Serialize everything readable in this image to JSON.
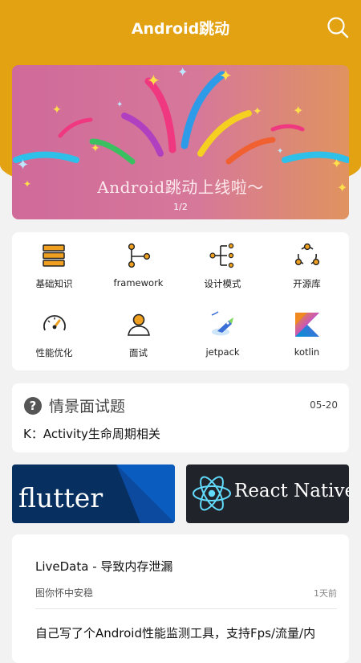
{
  "appbar": {
    "title": "Android跳动"
  },
  "banner": {
    "title": "Android跳动上线啦～",
    "page_indicator": "1/2"
  },
  "categories": [
    {
      "label": "基础知识",
      "icon": "layers-icon"
    },
    {
      "label": "framework",
      "icon": "branch-icon"
    },
    {
      "label": "设计模式",
      "icon": "tree-structure-icon"
    },
    {
      "label": "开源库",
      "icon": "cycle-icon"
    },
    {
      "label": "性能优化",
      "icon": "gauge-icon"
    },
    {
      "label": "面试",
      "icon": "person-icon"
    },
    {
      "label": "jetpack",
      "icon": "jetpack-logo-icon"
    },
    {
      "label": "kotlin",
      "icon": "kotlin-logo-icon"
    }
  ],
  "question": {
    "title": "情景面试题",
    "date": "05-20",
    "text": "K：Activity生命周期相关"
  },
  "promos": {
    "flutter": "flutter",
    "react": "React Native"
  },
  "articles": [
    {
      "title": "LiveData - 导致内存泄漏",
      "author": "图你怀中安稳",
      "time": "1天前"
    },
    {
      "title": "自己写了个Android性能监测工具，支持Fps/流量/内"
    }
  ],
  "colors": {
    "accent": "#e2a212",
    "icon_orange": "#f0a020",
    "background": "#f2f2f2"
  }
}
